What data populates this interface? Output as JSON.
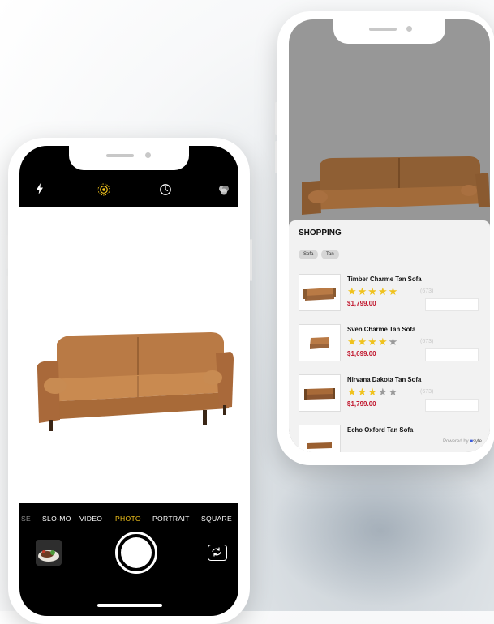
{
  "camera": {
    "modes": [
      "SE",
      "SLO-MO",
      "VIDEO",
      "PHOTO",
      "PORTRAIT",
      "SQUARE"
    ],
    "active_mode": "PHOTO",
    "icons": {
      "flash": "flash-icon",
      "live": "live-photo-icon",
      "timer": "timer-icon",
      "filters": "filters-icon",
      "flip": "camera-flip-icon"
    },
    "accent_color": "#f4c51c"
  },
  "shopping": {
    "title": "SHOPPING",
    "chips": [
      "Sofa",
      "Tan"
    ],
    "items": [
      {
        "name": "Timber Charme Tan Sofa",
        "rating": 5,
        "count": "(673)",
        "price": "$1,799.00"
      },
      {
        "name": "Sven Charme Tan Sofa",
        "rating": 4,
        "count": "(673)",
        "price": "$1,699.00"
      },
      {
        "name": "Nirvana Dakota Tan Sofa",
        "rating": 3,
        "count": "(673)",
        "price": "$1,799.00"
      },
      {
        "name": "Echo Oxford Tan Sofa",
        "rating": 0,
        "count": "",
        "price": ""
      }
    ],
    "powered_by": "Powered by",
    "brand": "syte",
    "price_color": "#c0152c",
    "star_color": "#f0c21c"
  }
}
